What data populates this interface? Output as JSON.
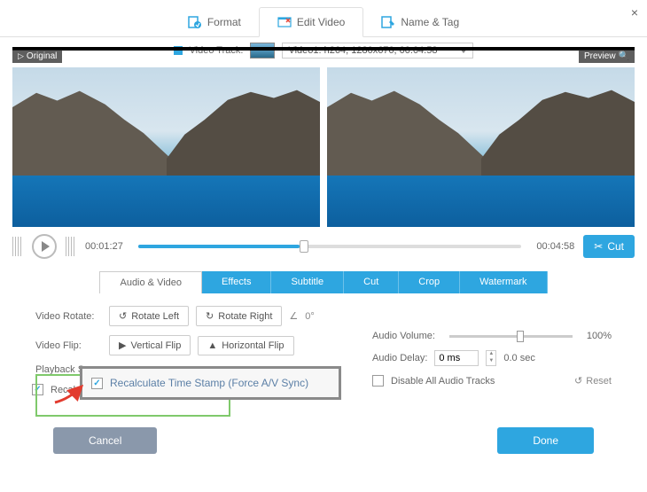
{
  "window": {
    "close": "×"
  },
  "tabs": {
    "format": "Format",
    "edit": "Edit Video",
    "name": "Name & Tag"
  },
  "track": {
    "label": "Video Track:",
    "value": "Video1: h264, 1280x676, 00:04:58"
  },
  "badge": {
    "original": "Original",
    "preview": "Preview"
  },
  "transport": {
    "current": "00:01:27",
    "total": "00:04:58",
    "cut": "Cut"
  },
  "subtabs": {
    "av": "Audio & Video",
    "effects": "Effects",
    "subtitle": "Subtitle",
    "cut": "Cut",
    "crop": "Crop",
    "watermark": "Watermark"
  },
  "opts": {
    "rotate_label": "Video Rotate:",
    "rotate_left": "Rotate Left",
    "rotate_right": "Rotate Right",
    "angle": "0°",
    "flip_label": "Video Flip:",
    "vflip": "Vertical Flip",
    "hflip": "Horizontal Flip",
    "playback_label": "Playback Sp",
    "recalc_short": "Recalcu",
    "vol_label": "Audio Volume:",
    "vol_value": "100%",
    "delay_label": "Audio Delay:",
    "delay_ms": "0 ms",
    "delay_sec": "0.0 sec",
    "disable_audio": "Disable All Audio Tracks",
    "reset": "Reset"
  },
  "overlay": {
    "recalc": "Recalculate Time Stamp (Force A/V Sync)"
  },
  "footer": {
    "cancel": "Cancel",
    "done": "Done"
  }
}
